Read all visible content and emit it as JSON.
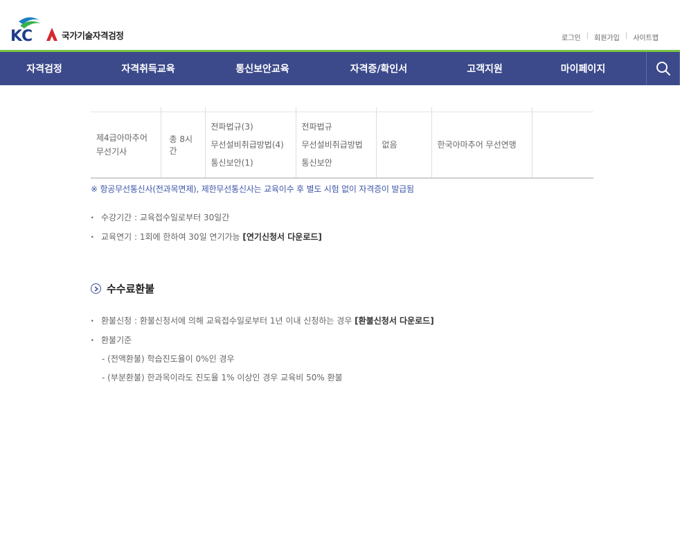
{
  "header": {
    "logo_text": "국가기술자격검정",
    "util_links": [
      "로그인",
      "회원가입",
      "사이트맵"
    ]
  },
  "nav": {
    "items": [
      "자격검정",
      "자격취득교육",
      "통신보안교육",
      "자격증/확인서",
      "고객지원",
      "마이페이지"
    ]
  },
  "table": {
    "cells": {
      "name": [
        "제4급아마추어",
        "무선기사"
      ],
      "hours": "총 8시간",
      "subjects": [
        "전파법규(3)",
        "무선설비취급방법(4)",
        "통신보안(1)"
      ],
      "exam": [
        "전파법규",
        "무선설비취급방법",
        "통신보안"
      ],
      "exemption": "없음",
      "org": "한국아마추어 무선연맹",
      "extra": ""
    }
  },
  "note": "※ 항공무선통신사(전과목면제), 제한무선통신사는 교육이수 후 별도 시험 없이 자격증이 발급됨",
  "info": {
    "period": "수강기간 : 교육접수일로부터 30일간",
    "extension": "교육연기 : 1회에 한하여 30일 연기가능 ",
    "extension_download": "[연기신청서 다운로드]"
  },
  "refund": {
    "title": "수수료환불",
    "apply": "환불신청 : 환불신청서에 의해 교육접수일로부터 1년 이내 신청하는 경우 ",
    "apply_download": "[환불신청서 다운로드]",
    "criteria": "환불기준",
    "full": "- (전액환불) 학습진도율이 0%인 경우",
    "partial": "- (부분환불) 한과목이라도 진도율 1% 이상인 경우 교육비 50% 환불"
  },
  "colors": {
    "nav_bg": "#3c4a8b",
    "nav_line": "#7cc341",
    "note_blue": "#3e55a8",
    "logo_red": "#d6272e"
  }
}
